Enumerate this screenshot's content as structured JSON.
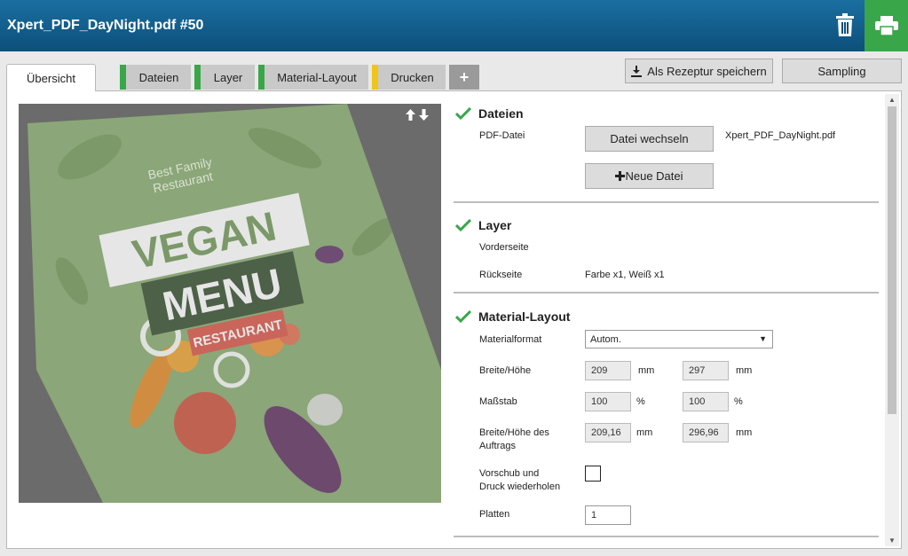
{
  "window": {
    "title": "Xpert_PDF_DayNight.pdf #50"
  },
  "tabs": [
    {
      "label": "Übersicht",
      "stripe": ""
    },
    {
      "label": "Dateien",
      "stripe": "#3aa64a"
    },
    {
      "label": "Layer",
      "stripe": "#3aa64a"
    },
    {
      "label": "Material-Layout",
      "stripe": "#3aa64a"
    },
    {
      "label": "Drucken",
      "stripe": "#f0c419"
    },
    {
      "label": "+",
      "stripe": ""
    }
  ],
  "toolbar": {
    "save_recipe": "Als Rezeptur speichern",
    "sampling": "Sampling"
  },
  "preview": {
    "menu_text": {
      "line1": "Best Family",
      "line2": "Restaurant",
      "vegan": "VEGAN",
      "menu": "MENU",
      "restaurant": "RESTAURANT"
    }
  },
  "sections": {
    "dateien": {
      "title": "Dateien",
      "pdf_label": "PDF-Datei",
      "change_button": "Datei wechseln",
      "filename": "Xpert_PDF_DayNight.pdf",
      "new_button": "Neue Datei"
    },
    "layer": {
      "title": "Layer",
      "front_label": "Vorderseite",
      "back_label": "Rückseite",
      "back_value": "Farbe x1, Weiß x1"
    },
    "material": {
      "title": "Material-Layout",
      "format_label": "Materialformat",
      "format_value": "Autom.",
      "size_label": "Breite/Höhe",
      "width": "209",
      "height": "297",
      "size_unit": "mm",
      "scale_label": "Maßstab",
      "scale_w": "100",
      "scale_h": "100",
      "scale_unit": "%",
      "job_size_label_1": "Breite/Höhe des",
      "job_size_label_2": "Auftrags",
      "job_width": "209,16",
      "job_height": "296,96",
      "repeat_label_1": "Vorschub und",
      "repeat_label_2": "Druck wiederholen",
      "plates_label": "Platten",
      "plates_value": "1"
    }
  },
  "colors": {
    "accent_blue": "#0d4f7a",
    "print_green": "#3aa64a",
    "check_green": "#3aa64a",
    "tab_yellow": "#f0c419"
  }
}
